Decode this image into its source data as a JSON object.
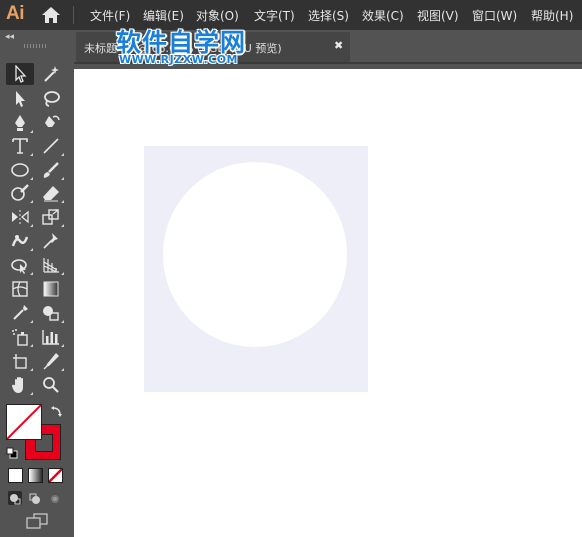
{
  "app": {
    "logo_text": "Ai",
    "logo_color": "#E8A065"
  },
  "menu": {
    "items": [
      "文件(F)",
      "编辑(E)",
      "对象(O)",
      "文字(T)",
      "选择(S)",
      "效果(C)",
      "视图(V)",
      "窗口(W)",
      "帮助(H)"
    ]
  },
  "toolbar": {
    "collapse_glyph": "◂◂",
    "tools": [
      "selection-tool-icon",
      "magic-wand-tool-icon",
      "direct-selection-tool-icon",
      "lasso-tool-icon",
      "pen-tool-icon",
      "curvature-tool-icon",
      "type-tool-icon",
      "line-segment-tool-icon",
      "ellipse-tool-icon",
      "paintbrush-tool-icon",
      "shaper-tool-icon",
      "eraser-tool-icon",
      "reflect-tool-icon",
      "scale-tool-icon",
      "puppet-warp-tool-icon",
      "pin-tool-icon",
      "free-transform-tool-icon",
      "perspective-grid-tool-icon",
      "mesh-tool-icon",
      "gradient-tool-icon",
      "eyedropper-tool-icon",
      "shape-builder-tool-icon",
      "symbol-sprayer-tool-icon",
      "column-graph-tool-icon",
      "artboard-tool-icon",
      "slice-tool-icon",
      "hand-tool-icon",
      "zoom-tool-icon"
    ],
    "fill_color": "#FFFFFF",
    "stroke_color": "#E6001B"
  },
  "document": {
    "tab_title": "未标题-1* @ 66.67% (RGB/GPU 预览)",
    "close_glyph": "✖"
  },
  "watermark": {
    "title": "软件自学网",
    "url": "WWW.RJZXW.COM"
  },
  "canvas": {
    "background_color": "#FFFFFF",
    "rect_color": "#EEEEF8",
    "circle_color": "#FFFFFF"
  }
}
